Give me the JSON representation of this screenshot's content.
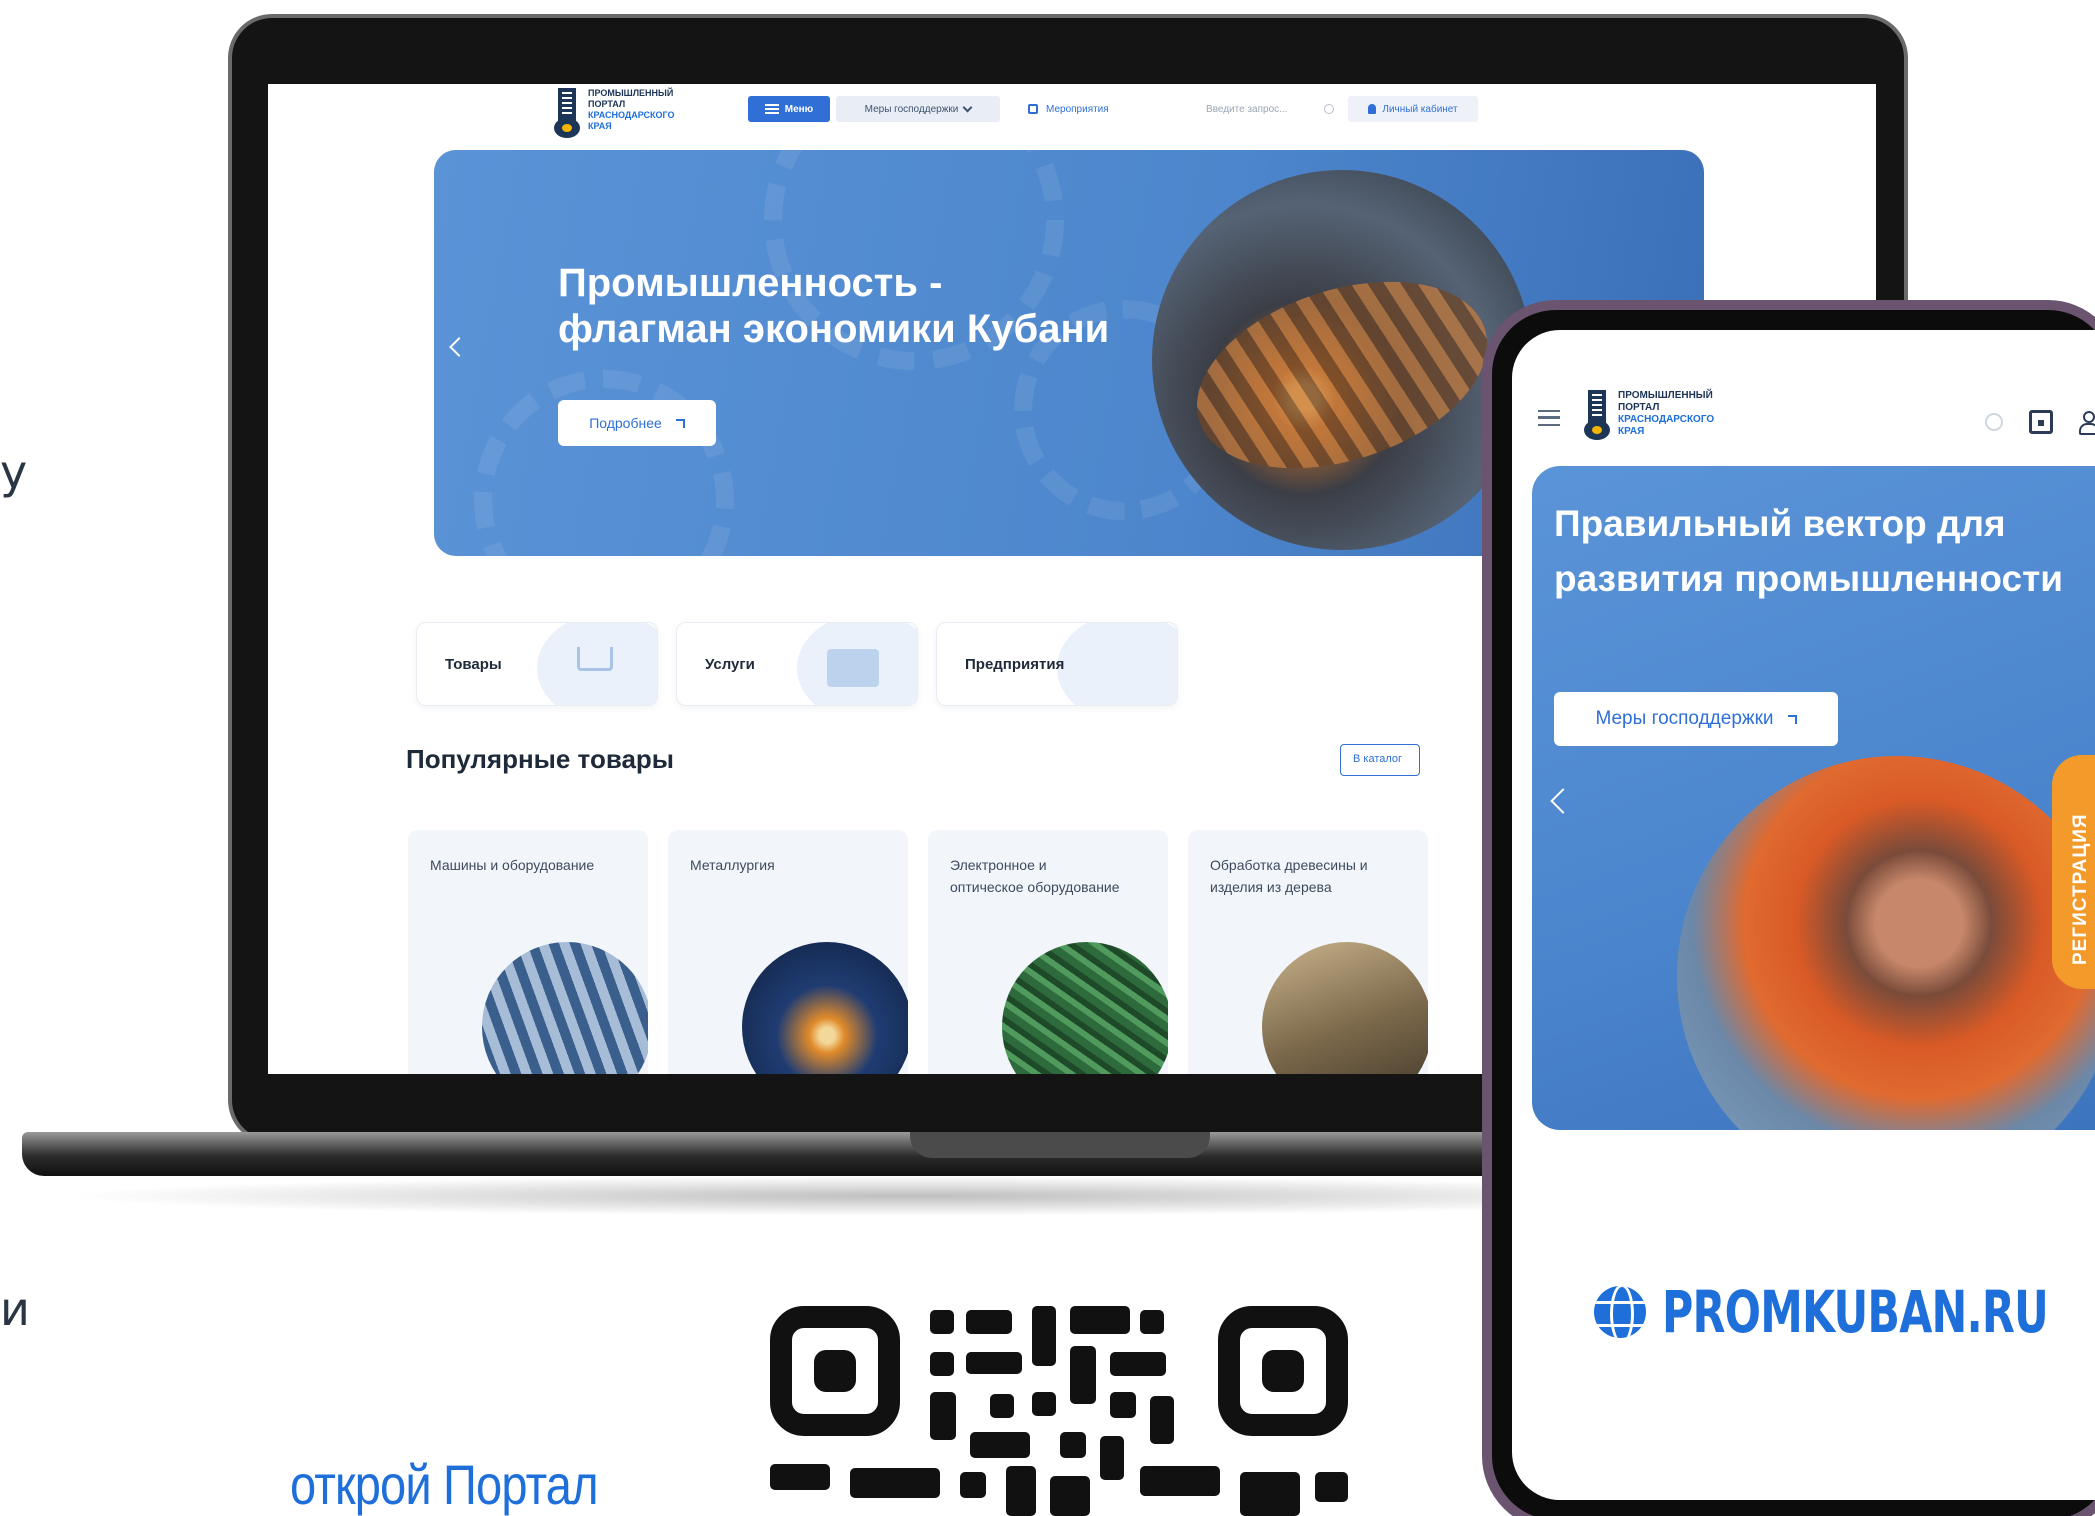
{
  "edge_fragments": [
    "у",
    "и"
  ],
  "laptop": {
    "header": {
      "logo_line1": "ПРОМЫШЛЕННЫЙ",
      "logo_line2": "ПОРТАЛ",
      "logo_line3": "КРАСНОДАРСКОГО",
      "logo_line4": "КРАЯ",
      "menu_label": "Меню",
      "support_label": "Меры господдержки",
      "events_label": "Мероприятия",
      "search_placeholder": "Введите запрос...",
      "cabinet_label": "Личный кабинет"
    },
    "hero": {
      "title_line1": "Промышленность -",
      "title_line2": "флагман экономики Кубани",
      "more_label": "Подробнее"
    },
    "categories": [
      {
        "label": "Товары",
        "icon": "cart-icon"
      },
      {
        "label": "Услуги",
        "icon": "briefcase-icon"
      },
      {
        "label": "Предприятия",
        "icon": "factory-icon"
      }
    ],
    "popular_title": "Популярные товары",
    "catalog_label": "В каталог",
    "products": [
      {
        "name": "Машины и оборудование"
      },
      {
        "name": "Металлургия"
      },
      {
        "name": "Электронное и оптическое оборудование"
      },
      {
        "name": "Обработка древесины и изделия из дерева"
      }
    ]
  },
  "phone": {
    "logo_line1": "ПРОМЫШЛЕННЫЙ",
    "logo_line2": "ПОРТАЛ",
    "logo_line3": "КРАСНОДАРСКОГО",
    "logo_line4": "КРАЯ",
    "hero_title": "Правильный вектор для развития промышленности",
    "hero_button": "Меры господдержки",
    "register_tab": "РЕГИСТРАЦИЯ",
    "domain": "PROMKUBAN.RU"
  },
  "qr_caption": "открой Портал",
  "colors": {
    "brand_blue": "#2f6fd6",
    "hero_blue": "#4d86cc",
    "accent_orange": "#f39a2b",
    "dark_navy": "#1d3557"
  }
}
